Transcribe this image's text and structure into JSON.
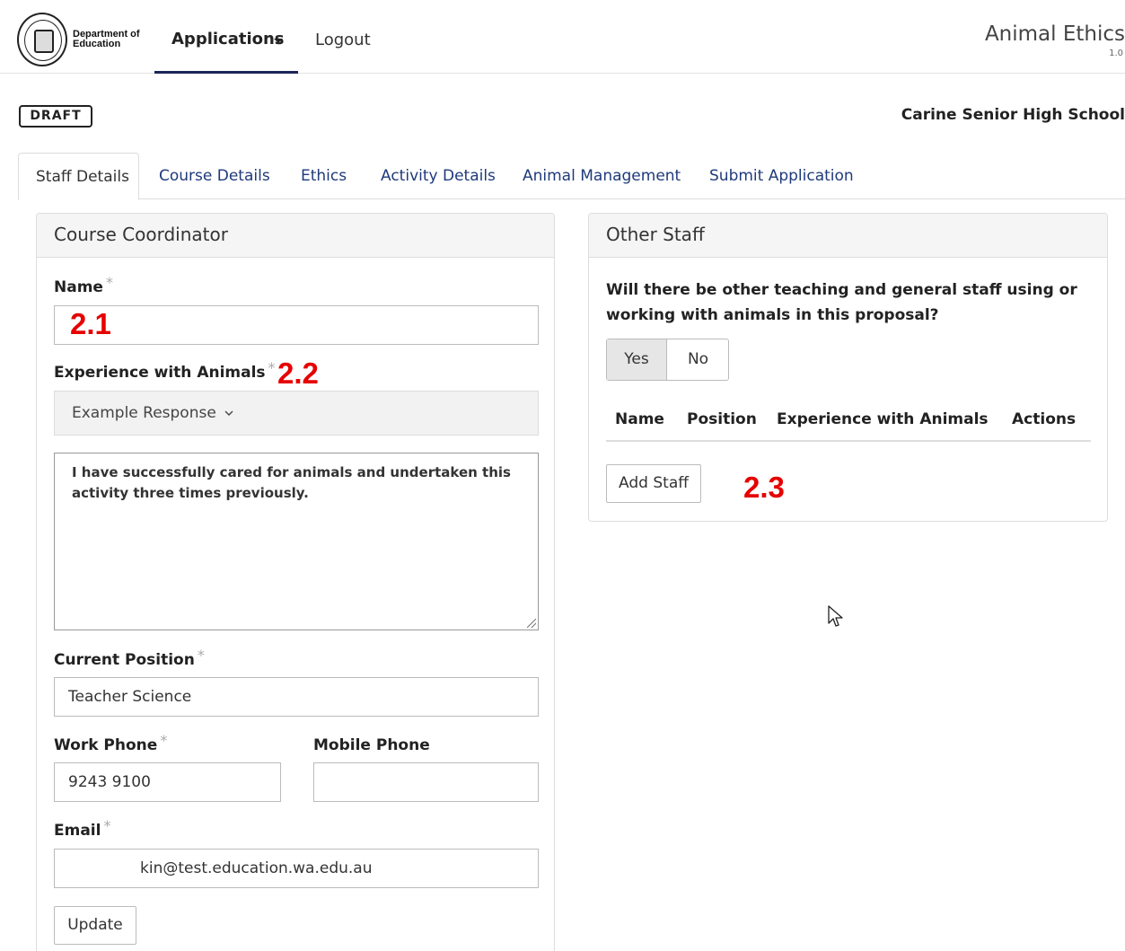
{
  "header": {
    "logo_text_line1": "Department of",
    "logo_text_line2": "Education",
    "nav_applications": "Applications",
    "nav_logout": "Logout",
    "app_title": "Animal Ethics",
    "app_version": "1.0",
    "logo_icon": "government-seal-icon",
    "caret_icon": "caret-down-icon"
  },
  "status": {
    "badge": "DRAFT",
    "school": "Carine Senior High School"
  },
  "tabs": [
    {
      "label": "Staff Details",
      "active": true
    },
    {
      "label": "Course Details",
      "active": false
    },
    {
      "label": "Ethics",
      "active": false
    },
    {
      "label": "Activity Details",
      "active": false
    },
    {
      "label": "Animal Management",
      "active": false
    },
    {
      "label": "Submit Application",
      "active": false
    }
  ],
  "coordinator": {
    "title": "Course Coordinator",
    "name_label": "Name",
    "name_value": "",
    "required_mark": "*",
    "experience_label": "Experience with Animals",
    "example_dropdown": "Example Response",
    "experience_text": "I have successfully cared for animals and undertaken this activity three times previously.",
    "position_label": "Current Position",
    "position_value": "Teacher Science",
    "work_phone_label": "Work Phone",
    "work_phone_value": "9243 9100",
    "mobile_phone_label": "Mobile Phone",
    "mobile_phone_value": "",
    "email_label": "Email",
    "email_value": "kin@test.education.wa.edu.au",
    "update_button": "Update"
  },
  "other_staff": {
    "title": "Other Staff",
    "question": "Will there be other teaching and general staff using or working with animals in this proposal?",
    "yes_label": "Yes",
    "no_label": "No",
    "selected": "Yes",
    "columns": [
      "Name",
      "Position",
      "Experience with Animals",
      "Actions"
    ],
    "rows": [],
    "add_button": "Add Staff"
  },
  "annotations": {
    "a1": "2.1",
    "a2": "2.2",
    "a3": "2.3"
  },
  "colors": {
    "annotation": "#e60000",
    "nav_underline": "#1c2557",
    "tab_link": "#1f3a7a"
  }
}
